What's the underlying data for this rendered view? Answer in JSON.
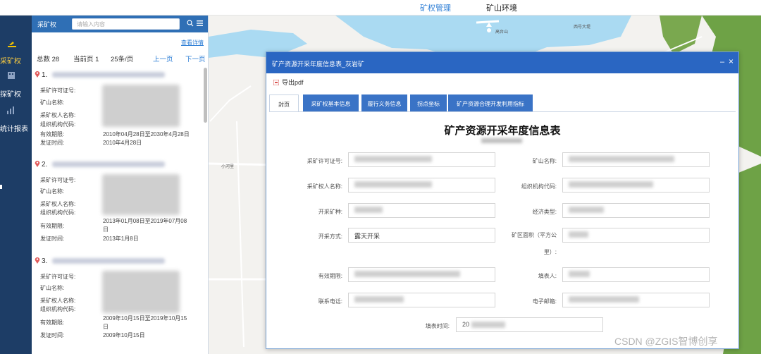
{
  "topbar": {
    "tabs": [
      {
        "label": "矿权管理",
        "active": true
      },
      {
        "label": "矿山环境",
        "active": false
      }
    ]
  },
  "leftnav": {
    "items": [
      {
        "label": "采矿权",
        "icon": "mining-icon"
      },
      {
        "label": "探矿权",
        "icon": "building-icon"
      },
      {
        "label": "统计报表",
        "icon": "chart-icon"
      }
    ]
  },
  "listpanel": {
    "title": "采矿权",
    "search_placeholder": "请输入内容",
    "view_detail": "查看详情",
    "total": "总数 28",
    "current_page": "当前页 1",
    "per_page": "25条/页",
    "prev": "上一页",
    "next": "下一页",
    "records": [
      {
        "index": "1.",
        "fields": {
          "license": "采矿许可证号:",
          "mine": "矿山名称:",
          "owner": "采矿权人名称:",
          "org": "组织机构代码:",
          "period": "有效期限:",
          "issue": "发证时间:"
        },
        "period_value": "2010年04月28日至2030年4月28日",
        "issue_value": "2010年4月28日"
      },
      {
        "index": "2.",
        "fields": {
          "license": "采矿许可证号:",
          "mine": "矿山名称:",
          "owner": "采矿权人名称:",
          "org": "组织机构代码:",
          "period": "有效期限:",
          "issue": "发证时间:"
        },
        "period_value_1": "2013年01月08日至2019年07月08",
        "period_value_2": "日",
        "issue_value": "2013年1月8日"
      },
      {
        "index": "3.",
        "fields": {
          "license": "采矿许可证号:",
          "mine": "矿山名称:",
          "owner": "采矿权人名称:",
          "org": "组织机构代码:",
          "period": "有效期限:",
          "issue": "发证时间:"
        },
        "period_value_1": "2009年10月15日至2019年10月15",
        "period_value_2": "日",
        "issue_value": "2009年10月15日"
      }
    ]
  },
  "dialog": {
    "title": "矿产资源开采年度信息表_灰岩矿",
    "export": "导出pdf",
    "tabs": [
      "封页",
      "采矿权基本信息",
      "履行义务信息",
      "拐点坐标",
      "矿产资源合理开发利用指标"
    ],
    "form_title": "矿产资源开采年度信息表",
    "fields": {
      "license": "采矿许可证号:",
      "mine": "矿山名称:",
      "owner": "采矿权人名称:",
      "org": "组织机构代码:",
      "mineral": "开采矿种:",
      "econ": "经济类型:",
      "method": "开采方式:",
      "method_value": "露天开采",
      "area_1": "矿区面积（平方公",
      "area_2": "里）:",
      "period": "有效期限:",
      "filler": "填表人:",
      "phone": "联系电话:",
      "email": "电子邮箱:",
      "time": "填表时间:"
    },
    "time_value": "20"
  },
  "map": {
    "labels": [
      "高台山",
      "西号大堤",
      "小河里"
    ]
  },
  "watermark": "CSDN @ZGIS智博创享",
  "colors": {
    "nav": "#1d3d66",
    "accent": "#2f6fb5",
    "dialog_header": "#2a66c2",
    "link": "#2f7fd6",
    "water": "#aadaf2",
    "park": "#6ea246"
  }
}
